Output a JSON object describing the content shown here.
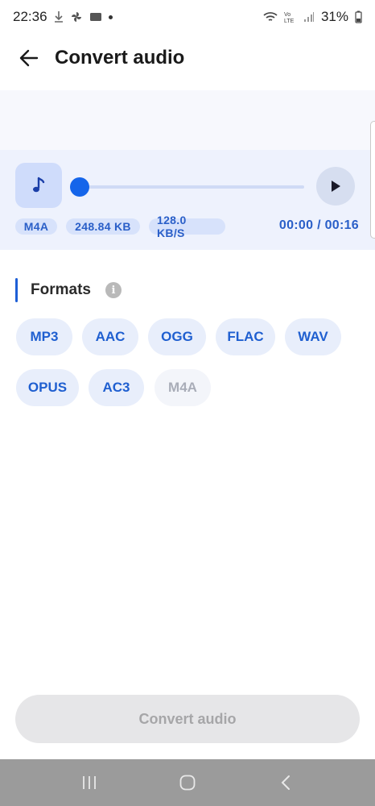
{
  "status_bar": {
    "time": "22:36",
    "battery": "31%"
  },
  "header": {
    "title": "Convert audio"
  },
  "player": {
    "format": "M4A",
    "file_size": "248.84 KB",
    "bitrate": "128.0 KB/S",
    "time": "00:00 / 00:16",
    "progress": 0
  },
  "formats_section": {
    "title": "Formats",
    "items": [
      {
        "label": "MP3",
        "enabled": true
      },
      {
        "label": "AAC",
        "enabled": true
      },
      {
        "label": "OGG",
        "enabled": true
      },
      {
        "label": "FLAC",
        "enabled": true
      },
      {
        "label": "WAV",
        "enabled": true
      },
      {
        "label": "OPUS",
        "enabled": true
      },
      {
        "label": "AC3",
        "enabled": true
      },
      {
        "label": "M4A",
        "enabled": false
      }
    ]
  },
  "convert_button": {
    "label": "Convert audio"
  },
  "colors": {
    "accent": "#1565ea",
    "chip_text": "#1f5fd0"
  }
}
